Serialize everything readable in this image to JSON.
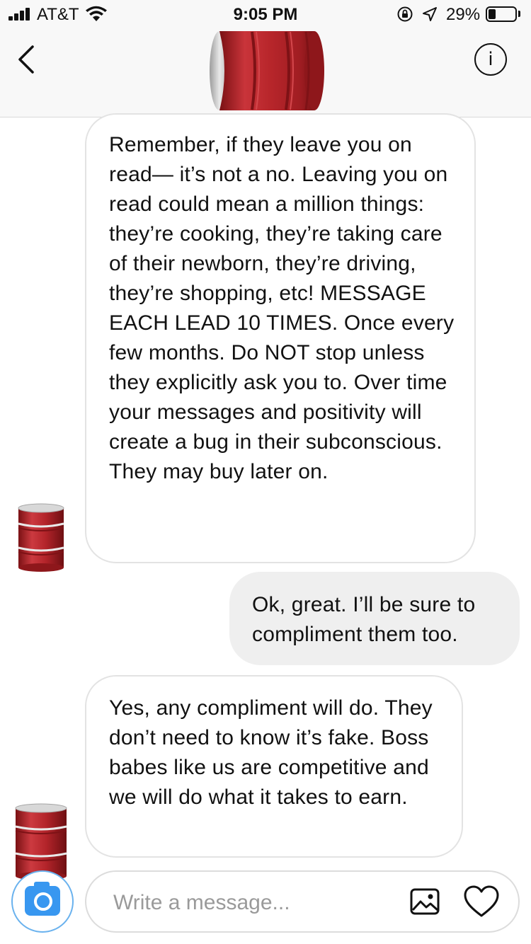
{
  "status_bar": {
    "carrier": "AT&T",
    "time": "9:05 PM",
    "battery_percent": "29%",
    "battery_level": 0.29
  },
  "header": {
    "back_icon": "chevron-left-icon",
    "avatar_icon": "red-oil-barrel-emoji",
    "info_icon": "info-icon",
    "info_glyph": "i"
  },
  "messages": [
    {
      "sender": "them",
      "text": "Remember, if they leave you on read— it’s not a no. Leaving you on read could mean a million things: they’re cooking, they’re taking care of their newborn, they’re driving, they’re shopping, etc! MESSAGE EACH LEAD 10 TIMES. Once every few months. Do NOT stop unless they explicitly ask you to. Over time your messages and positivity will create a bug in their subconscious. They may buy later on."
    },
    {
      "sender": "me",
      "text": "Ok, great. I’ll be sure to compliment them too."
    },
    {
      "sender": "them",
      "text": "Yes, any compliment will do. They don’t need to know it’s fake. Boss babes like us are competitive and we will do what it takes to earn."
    }
  ],
  "composer": {
    "placeholder": "Write a message...",
    "camera_icon": "camera-icon",
    "gallery_icon": "gallery-icon",
    "heart_icon": "heart-icon"
  },
  "colors": {
    "accent": "#3897f0",
    "barrel_red": "#b8262b",
    "outgoing_bubble": "#efefef",
    "incoming_border": "#e3e3e3"
  }
}
